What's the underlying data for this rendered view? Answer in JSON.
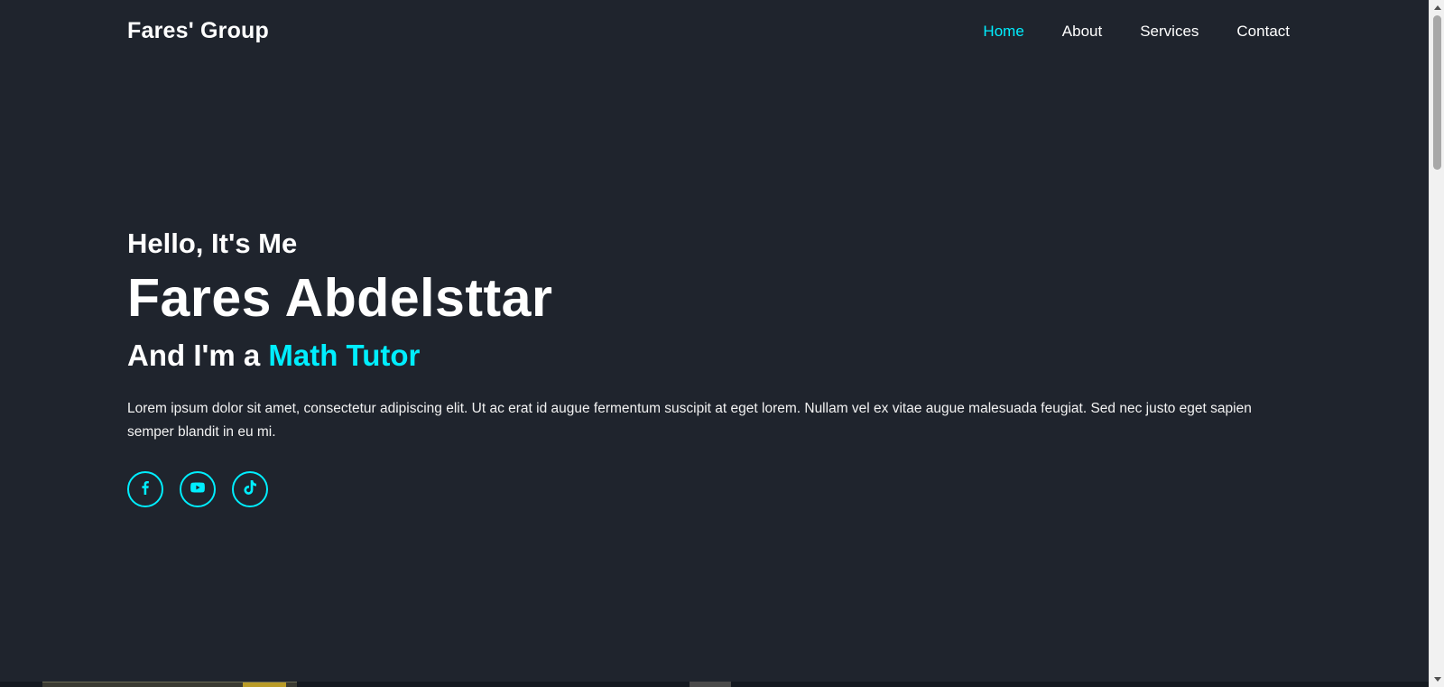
{
  "header": {
    "logo": "Fares' Group",
    "nav": [
      {
        "label": "Home",
        "active": true
      },
      {
        "label": "About",
        "active": false
      },
      {
        "label": "Services",
        "active": false
      },
      {
        "label": "Contact",
        "active": false
      }
    ]
  },
  "hero": {
    "greeting": "Hello, It's Me",
    "name": "Fares Abdelsttar",
    "role_prefix": "And I'm a ",
    "role": "Math Tutor",
    "bio": "Lorem ipsum dolor sit amet, consectetur adipiscing elit. Ut ac erat id augue fermentum suscipit at eget lorem. Nullam vel ex vitae augue malesuada feugiat. Sed nec justo eget sapien semper blandit in eu mi.",
    "socials": [
      {
        "icon": "facebook-icon"
      },
      {
        "icon": "youtube-icon"
      },
      {
        "icon": "tiktok-icon"
      }
    ]
  },
  "colors": {
    "background": "#1f242d",
    "accent": "#00eeff",
    "text": "#ffffff"
  }
}
